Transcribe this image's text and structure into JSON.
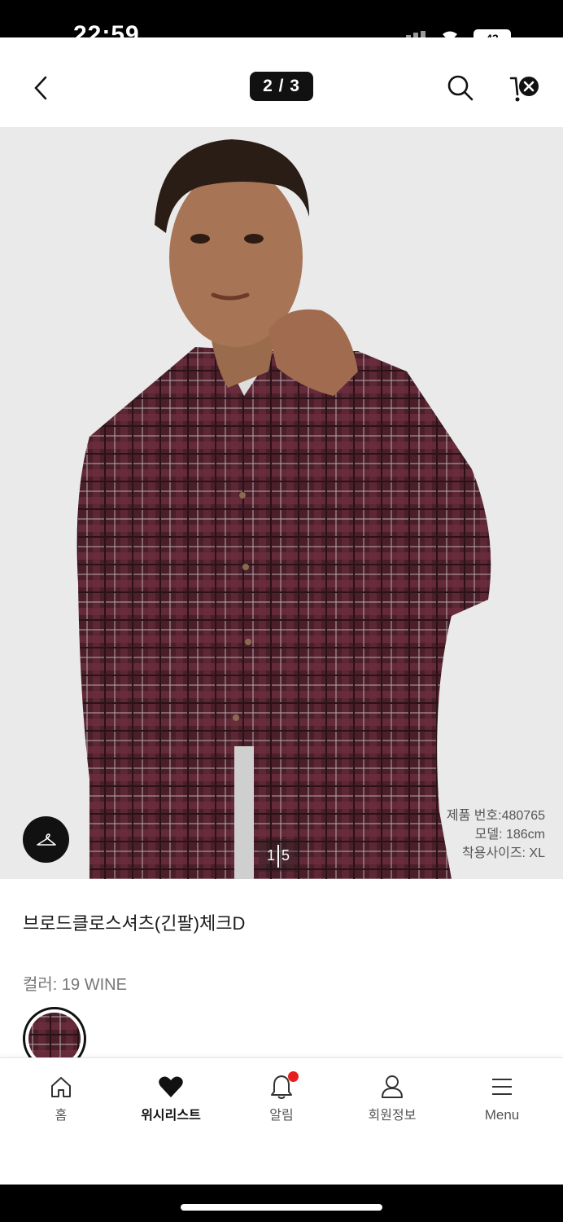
{
  "status_bar": {
    "time": "22:59",
    "battery": "43"
  },
  "header": {
    "page_counter": "2 / 3"
  },
  "hero": {
    "image_indicator_current": "1",
    "image_indicator_total": "5",
    "model_info": [
      "제품 번호:480765",
      "모델: 186cm",
      "착용사이즈: XL"
    ]
  },
  "product": {
    "title": "브로드클로스셔츠(긴팔)체크D",
    "color_label": "컬러: 19 WINE",
    "swatch_color": "#5a2330"
  },
  "tabs": [
    {
      "label": "홈",
      "icon": "home-icon"
    },
    {
      "label": "위시리스트",
      "icon": "heart-icon",
      "active": true
    },
    {
      "label": "알림",
      "icon": "bell-icon",
      "badge": true
    },
    {
      "label": "회원정보",
      "icon": "user-icon"
    },
    {
      "label": "Menu",
      "icon": "menu-icon"
    }
  ],
  "colors": {
    "accent": "#111111",
    "badge": "#e81f1f",
    "shirt": "#4a1f2a",
    "image_bg": "#eaeaea"
  }
}
